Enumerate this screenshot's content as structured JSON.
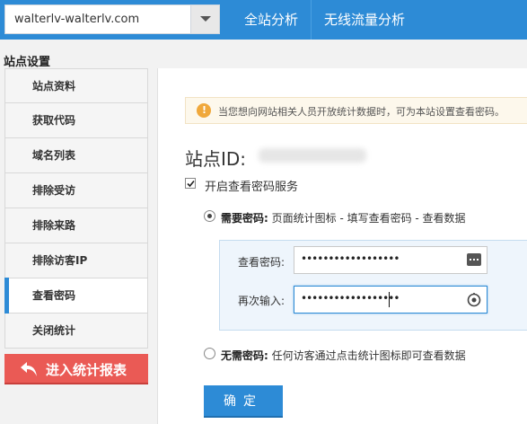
{
  "header": {
    "site_select_value": "walterlv-walterlv.com",
    "nav": [
      "全站分析",
      "无线流量分析"
    ]
  },
  "sidebar": {
    "title": "站点设置",
    "items": [
      {
        "label": "站点资料"
      },
      {
        "label": "获取代码"
      },
      {
        "label": "域名列表"
      },
      {
        "label": "排除受访"
      },
      {
        "label": "排除来路"
      },
      {
        "label": "排除访客IP"
      },
      {
        "label": "查看密码",
        "active": true
      },
      {
        "label": "关闭统计"
      }
    ],
    "report_button": "进入统计报表"
  },
  "main": {
    "notice": "当您想向网站相关人员开放统计数据时，可为本站设置查看密码。",
    "site_id_label": "站点ID:",
    "enable_label": "开启查看密码服务",
    "enable_checked": true,
    "option_need": {
      "title": "需要密码:",
      "desc": "页面统计图标 - 填写查看密码 - 查看数据",
      "selected": true
    },
    "option_none": {
      "title": "无需密码:",
      "desc": "任何访客通过点击统计图标即可查看数据",
      "selected": false
    },
    "password_label": "查看密码:",
    "password_value": "••••••••••••••••••",
    "repeat_label": "再次输入:",
    "repeat_value": "••••••••••••••••••",
    "confirm_label": "确定"
  },
  "colors": {
    "primary": "#2d8bd6",
    "report": "#ea5a55",
    "notice_bg": "#fdf8ec",
    "notice_icon": "#f0a83b"
  }
}
